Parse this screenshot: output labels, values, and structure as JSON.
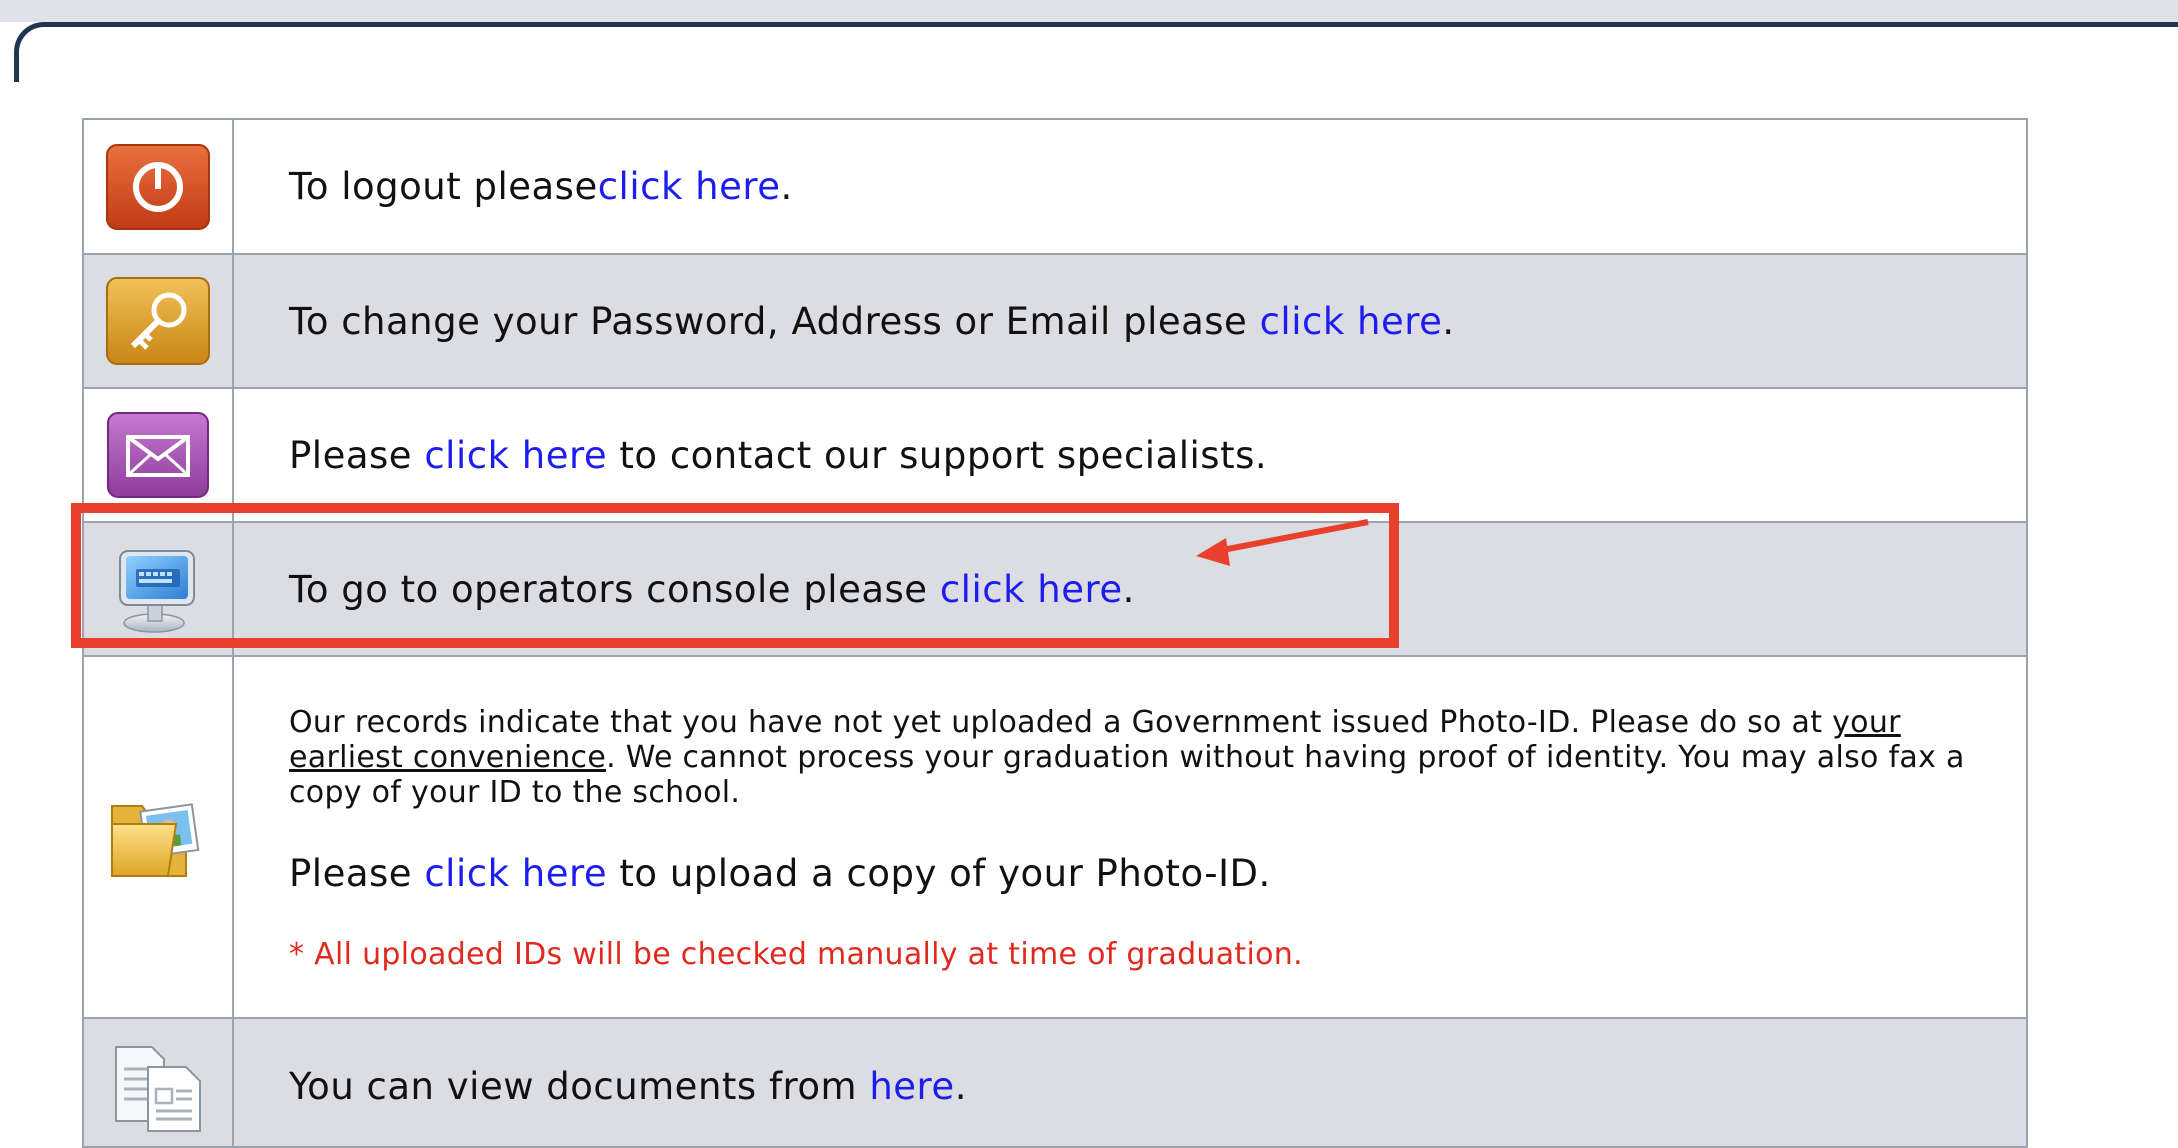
{
  "rows": [
    {
      "icon": "power-icon",
      "text_before": "To logout please ",
      "link": "click here",
      "text_after": "."
    },
    {
      "icon": "key-icon",
      "text_before": "To change your Password, Address or Email please ",
      "link": "click here",
      "text_after": "."
    },
    {
      "icon": "envelope-icon",
      "text_before": "Please ",
      "link": "click here",
      "text_after": " to contact our support specialists."
    },
    {
      "icon": "computer-icon",
      "text_before": "To go to operators console please ",
      "link": "click here",
      "text_after": "."
    },
    {
      "icon": "photo-folder-icon",
      "notice_before": "Our records indicate that you have not yet uploaded a Government issued Photo-ID. Please do so at ",
      "notice_underline": "your earliest convenience",
      "notice_after": ". We cannot process your graduation without having proof of identity. You may also fax a copy of your ID to the school.",
      "text_before": "Please ",
      "link": "click here",
      "text_after": " to upload a copy of your Photo-ID.",
      "note": "* All uploaded IDs will be checked manually at time of graduation."
    },
    {
      "icon": "documents-icon",
      "text_before": "You can view documents from ",
      "link": "here",
      "text_after": "."
    }
  ],
  "colors": {
    "link": "#1d1df0",
    "highlight": "#e8412b",
    "note": "#e02a1f",
    "row_shaded": "#dcdde3"
  }
}
